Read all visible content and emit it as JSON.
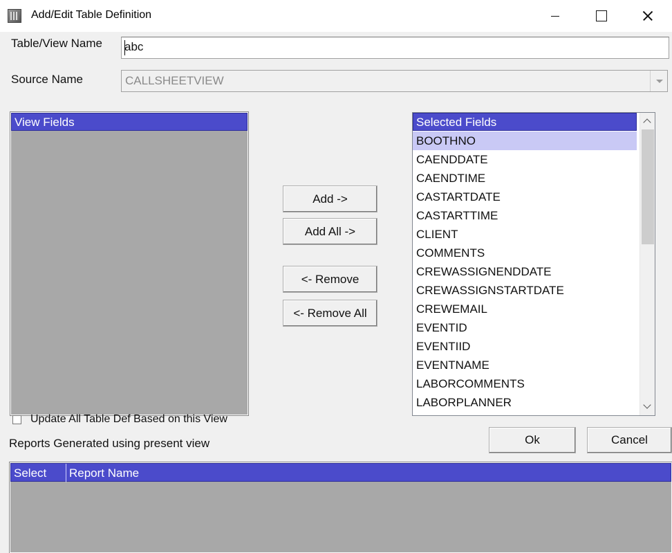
{
  "window": {
    "title": "Add/Edit Table Definition",
    "minimize": "",
    "maximize": "",
    "close": ""
  },
  "form": {
    "table_view_name_label": "Table/View Name",
    "table_view_name_value": "abc",
    "source_name_label": "Source Name",
    "source_name_value": "CALLSHEETVIEW"
  },
  "view_fields": {
    "header": "View Fields"
  },
  "buttons": {
    "add": "Add ->",
    "add_all": "Add All ->",
    "remove": "<- Remove",
    "remove_all": "<- Remove All",
    "ok": "Ok",
    "cancel": "Cancel"
  },
  "selected_fields": {
    "header": "Selected Fields",
    "items": [
      "BOOTHNO",
      "CAENDDATE",
      "CAENDTIME",
      "CASTARTDATE",
      "CASTARTTIME",
      "CLIENT",
      "COMMENTS",
      "CREWASSIGNENDDATE",
      "CREWASSIGNSTARTDATE",
      "CREWEMAIL",
      "EVENTID",
      "EVENTIID",
      "EVENTNAME",
      "LABORCOMMENTS",
      "LABORPLANNER"
    ],
    "highlighted_item": "BOOTHNO"
  },
  "options": {
    "update_all_label": "Update All Table Def Based on this View",
    "update_all_checked": false
  },
  "reports": {
    "label": "Reports Generated using present view",
    "columns": [
      "Select",
      "Report Name"
    ]
  },
  "colors": {
    "header_blue": "#4b4bcb",
    "panel_gray": "#a8a8a8",
    "highlight": "#c9c9f5"
  }
}
